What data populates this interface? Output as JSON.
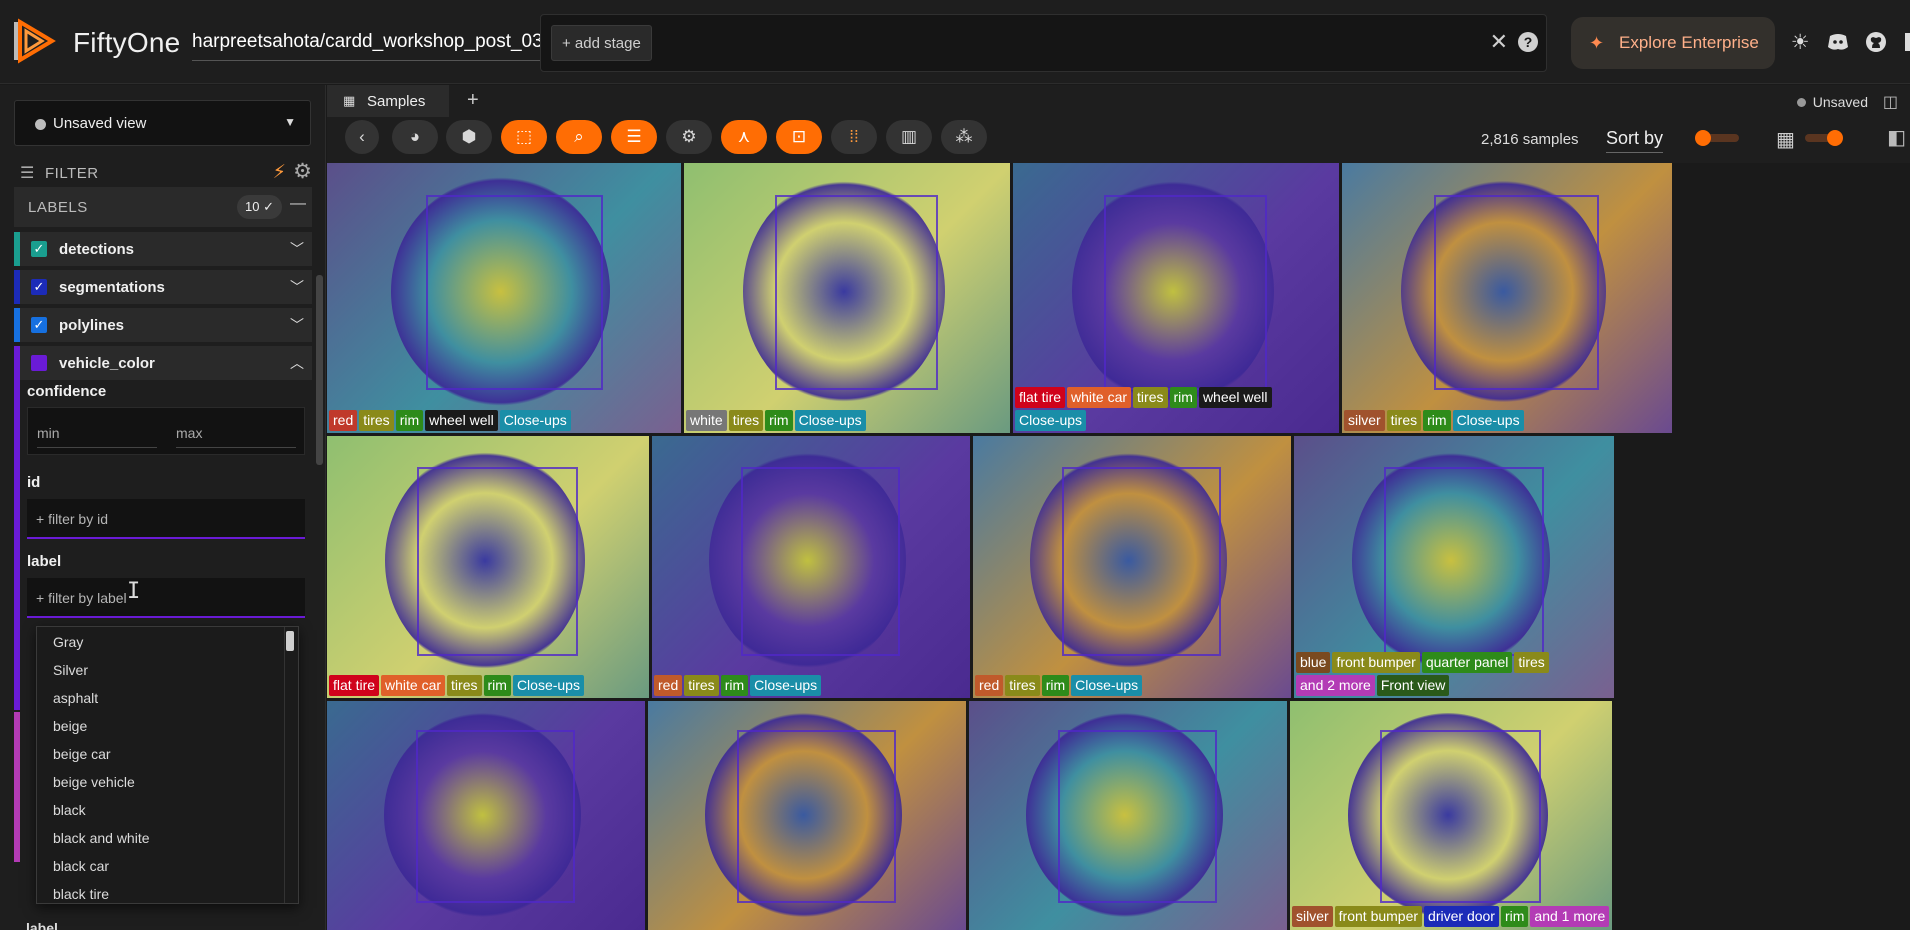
{
  "header": {
    "brand": "FiftyOne",
    "dataset": "harpreetsahota/cardd_workshop_post_03",
    "add_stage": "+ add stage",
    "close_glyph": "✕",
    "help_glyph": "?",
    "enterprise_label": "Explore Enterprise",
    "icons": [
      "sun-icon",
      "discord-icon",
      "github-icon",
      "book-icon"
    ]
  },
  "sidebar": {
    "view_selector": "Unsaved view",
    "filter_label": "FILTER",
    "labels_header": "LABELS",
    "labels_count": "10 ✓",
    "fields": [
      {
        "name": "detections",
        "color": "#1a9e8f",
        "checked": true,
        "chevron": "⌄"
      },
      {
        "name": "segmentations",
        "color": "#1c2bb8",
        "checked": true,
        "chevron": "⌄"
      },
      {
        "name": "polylines",
        "color": "#1670e0",
        "checked": true,
        "chevron": "⌄"
      },
      {
        "name": "vehicle_color",
        "color": "#6a1bd6",
        "checked": false,
        "chevron": "⌃"
      }
    ],
    "confidence_label": "confidence",
    "min_placeholder": "min",
    "max_placeholder": "max",
    "id_label": "id",
    "id_placeholder": "+ filter by id",
    "label_label": "label",
    "label_placeholder": "+ filter by label",
    "label_options": [
      "Gray",
      "Silver",
      "asphalt",
      "beige",
      "beige car",
      "beige vehicle",
      "black",
      "black and white",
      "black car",
      "black tire"
    ],
    "bottom_label": "label"
  },
  "tabs": {
    "samples": "Samples",
    "add": "+",
    "unsaved": "Unsaved"
  },
  "toolbar": {
    "sample_count": "2,816 samples",
    "sort_by": "Sort by",
    "buttons": [
      {
        "icon": "back-icon",
        "active": false
      },
      {
        "icon": "palette-icon",
        "active": false
      },
      {
        "icon": "tag-icon",
        "active": false
      },
      {
        "icon": "patches-icon",
        "active": true
      },
      {
        "icon": "search-icon",
        "active": true
      },
      {
        "icon": "list-icon",
        "active": true
      },
      {
        "icon": "settings-icon",
        "active": false
      },
      {
        "icon": "embeddings-icon",
        "active": true
      },
      {
        "icon": "inspect-icon",
        "active": true
      },
      {
        "icon": "grid-dots-icon",
        "active": false
      },
      {
        "icon": "bar-chart-icon",
        "active": false
      },
      {
        "icon": "nodes-icon",
        "active": false
      }
    ]
  },
  "grid": {
    "rows": [
      [
        {
          "tags": [
            [
              "red",
              "#c0392b"
            ],
            [
              "tires",
              "#8a8a1a"
            ],
            [
              "rim",
              "#2e8b1a"
            ],
            [
              "wheel well",
              "#1a1a1a"
            ],
            [
              "Close-ups",
              "#1a8ea8"
            ]
          ]
        },
        {
          "tags": [
            [
              "white",
              "#777"
            ],
            [
              "tires",
              "#8a8a1a"
            ],
            [
              "rim",
              "#2e8b1a"
            ],
            [
              "Close-ups",
              "#1a8ea8"
            ]
          ]
        },
        {
          "tags": [
            [
              "flat tire",
              "#d0021b"
            ],
            [
              "white car",
              "#e0602a"
            ],
            [
              "tires",
              "#8a8a1a"
            ],
            [
              "rim",
              "#2e8b1a"
            ],
            [
              "wheel well",
              "#1a1a1a"
            ],
            [
              "Close-ups",
              "#1a8ea8"
            ]
          ]
        },
        {
          "tags": [
            [
              "silver",
              "#a0522d"
            ],
            [
              "tires",
              "#8a8a1a"
            ],
            [
              "rim",
              "#2e8b1a"
            ],
            [
              "Close-ups",
              "#1a8ea8"
            ]
          ]
        }
      ],
      [
        {
          "tags": [
            [
              "flat tire",
              "#d0021b"
            ],
            [
              "white car",
              "#e0602a"
            ],
            [
              "tires",
              "#8a8a1a"
            ],
            [
              "rim",
              "#2e8b1a"
            ],
            [
              "Close-ups",
              "#1a8ea8"
            ]
          ]
        },
        {
          "tags": [
            [
              "red",
              "#c05a2b"
            ],
            [
              "tires",
              "#8a8a1a"
            ],
            [
              "rim",
              "#2e8b1a"
            ],
            [
              "Close-ups",
              "#1a8ea8"
            ]
          ]
        },
        {
          "tags": [
            [
              "red",
              "#c05a2b"
            ],
            [
              "tires",
              "#8a8a1a"
            ],
            [
              "rim",
              "#2e8b1a"
            ],
            [
              "Close-ups",
              "#1a8ea8"
            ]
          ]
        },
        {
          "tags": [
            [
              "blue",
              "#7a4a20"
            ],
            [
              "front bumper",
              "#8a8a1a"
            ],
            [
              "quarter panel",
              "#2e8b1a"
            ],
            [
              "tires",
              "#8a8a1a"
            ],
            [
              "and 2 more",
              "#b33bb5"
            ],
            [
              "Front view",
              "#2a5a1a"
            ]
          ]
        }
      ],
      [
        {
          "tags": []
        },
        {
          "tags": []
        },
        {
          "tags": []
        },
        {
          "tags": [
            [
              "silver",
              "#a0522d"
            ],
            [
              "front bumper",
              "#8a8a1a"
            ],
            [
              "driver door",
              "#1c2bb8"
            ],
            [
              "rim",
              "#2e8b1a"
            ],
            [
              "and 1 more",
              "#b33bb5"
            ]
          ]
        }
      ]
    ]
  }
}
